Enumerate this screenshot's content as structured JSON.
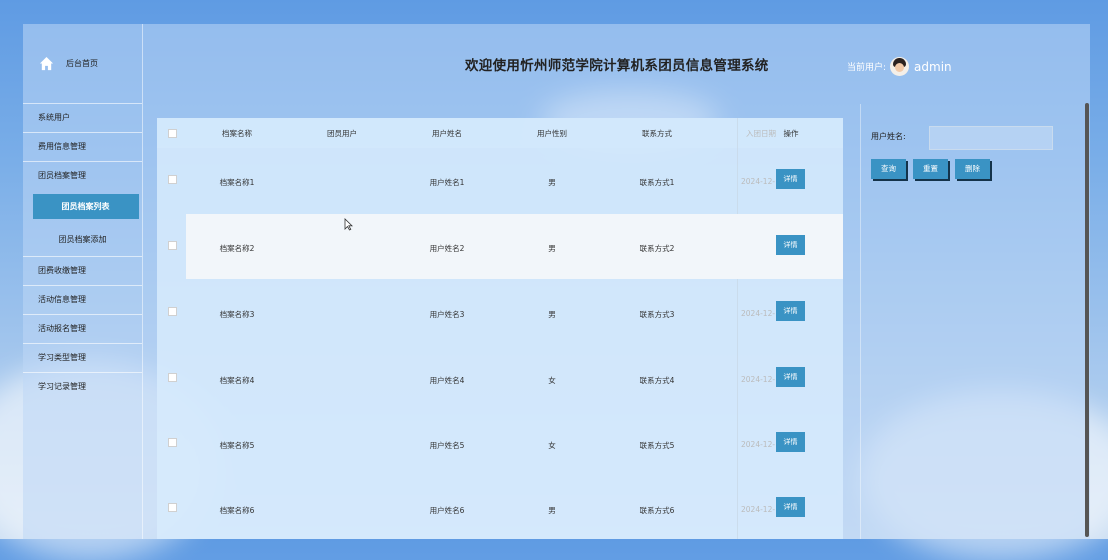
{
  "sidebar": {
    "home_label": "后台首页",
    "items": [
      "系统用户",
      "费用信息管理",
      "团员档案管理"
    ],
    "sub_items": [
      "团员档案列表",
      "团员档案添加"
    ],
    "items2": [
      "团费收缴管理",
      "活动信息管理",
      "活动报名管理",
      "学习类型管理",
      "学习记录管理"
    ]
  },
  "header": {
    "title": "欢迎使用忻州师范学院计算机系团员信息管理系统",
    "current_user_label": "当前用户:",
    "username": "admin"
  },
  "table": {
    "columns": [
      "档案名称",
      "团员用户",
      "用户姓名",
      "用户性别",
      "联系方式",
      "入团日期",
      "操作"
    ],
    "rows": [
      {
        "name": "档案名称1",
        "member": "",
        "username": "用户姓名1",
        "gender": "男",
        "contact": "联系方式1",
        "date": "2024-12-",
        "action": "详情"
      },
      {
        "name": "档案名称2",
        "member": "",
        "username": "用户姓名2",
        "gender": "男",
        "contact": "联系方式2",
        "date": "",
        "action": "详情"
      },
      {
        "name": "档案名称3",
        "member": "",
        "username": "用户姓名3",
        "gender": "男",
        "contact": "联系方式3",
        "date": "2024-12-",
        "action": "详情"
      },
      {
        "name": "档案名称4",
        "member": "",
        "username": "用户姓名4",
        "gender": "女",
        "contact": "联系方式4",
        "date": "2024-12-",
        "action": "详情"
      },
      {
        "name": "档案名称5",
        "member": "",
        "username": "用户姓名5",
        "gender": "女",
        "contact": "联系方式5",
        "date": "2024-12-",
        "action": "详情"
      },
      {
        "name": "档案名称6",
        "member": "",
        "username": "用户姓名6",
        "gender": "男",
        "contact": "联系方式6",
        "date": "2024-12-",
        "action": "详情"
      }
    ]
  },
  "search": {
    "label": "用户姓名:",
    "value": "",
    "query_button": "查询",
    "reset_button": "重置",
    "delete_button": "删除"
  },
  "colors": {
    "accent": "#3a93c4",
    "background": "#6fa5e5"
  }
}
